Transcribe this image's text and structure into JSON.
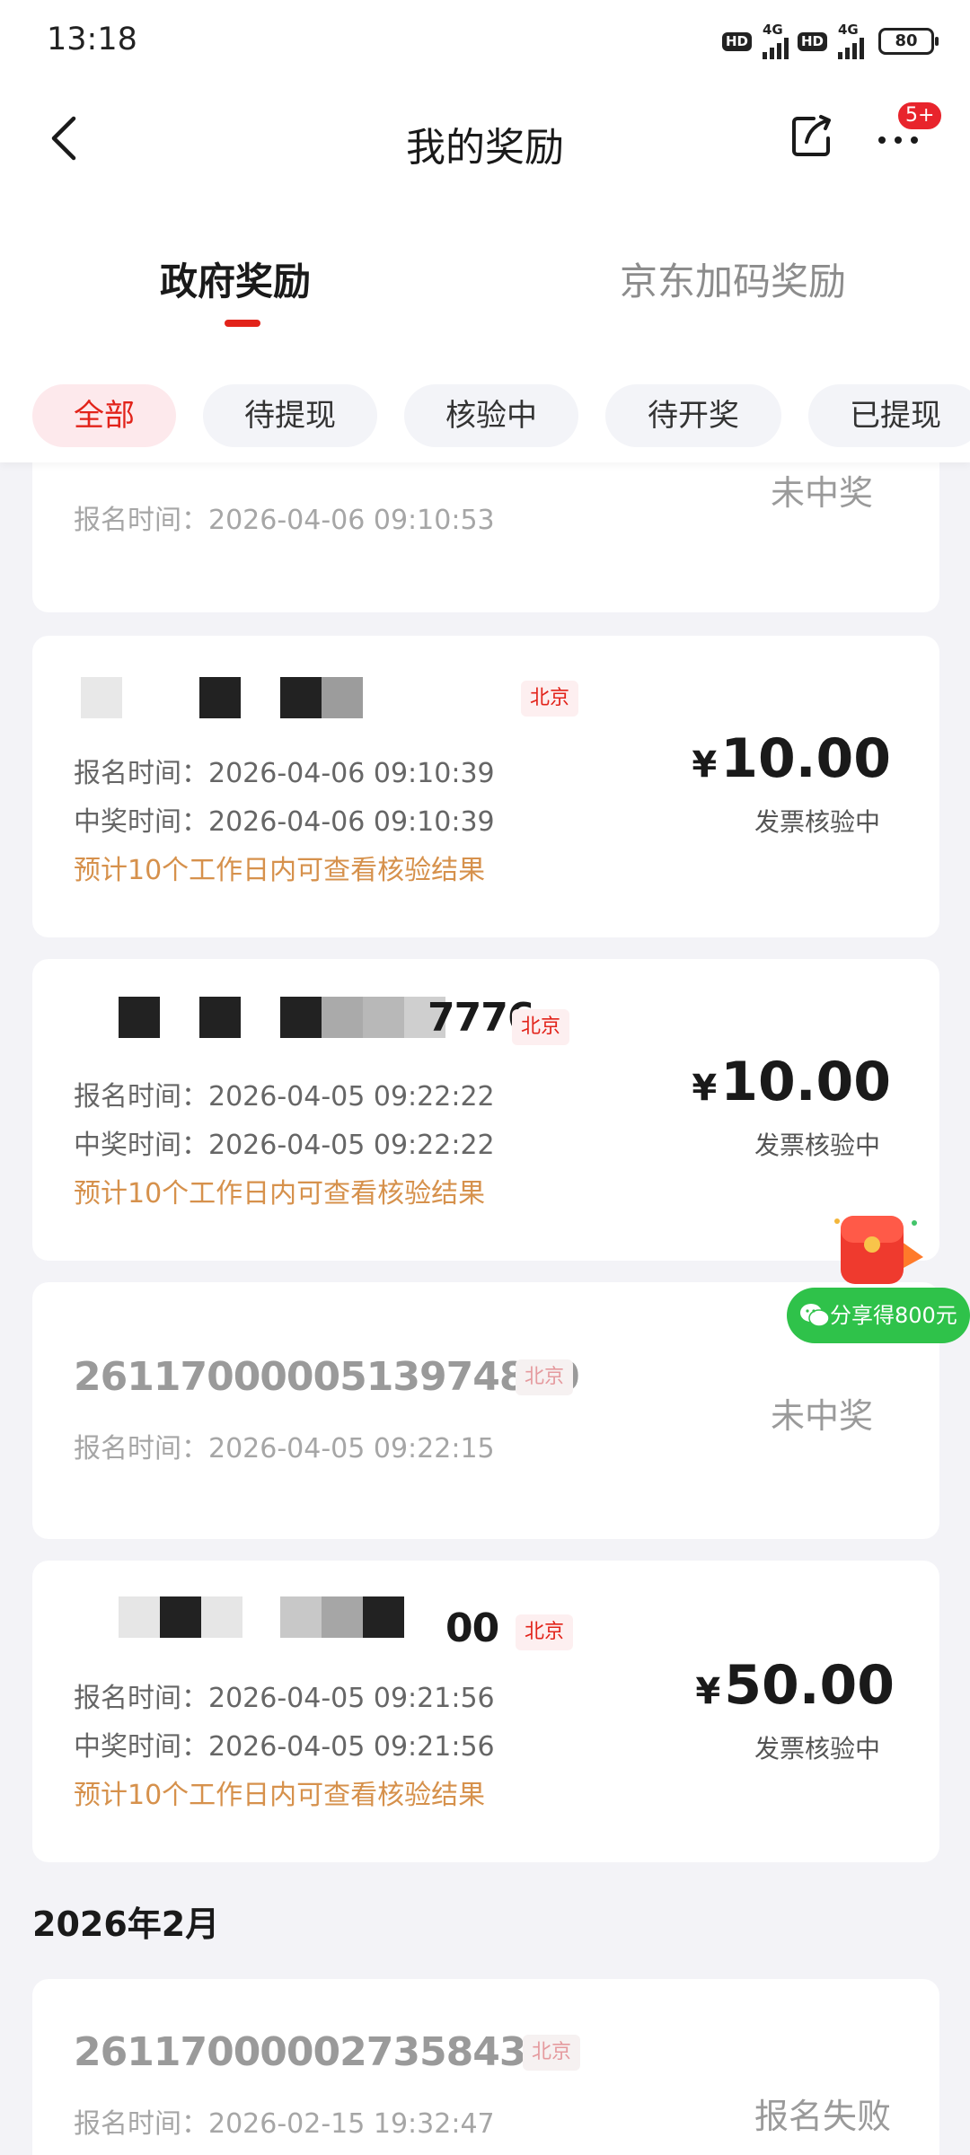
{
  "status_bar": {
    "time": "13:18",
    "battery": "80",
    "network": "4G",
    "hd": "HD"
  },
  "nav": {
    "title": "我的奖励",
    "badge": "5+"
  },
  "tabs": [
    {
      "label": "政府奖励",
      "active": true
    },
    {
      "label": "京东加码奖励",
      "active": false
    }
  ],
  "filters": [
    "全部",
    "待提现",
    "核验中",
    "待开奖",
    "已提现"
  ],
  "cards": [
    {
      "signup_time": "报名时间：2026-04-06 09:10:53",
      "status": "未中奖"
    },
    {
      "city": "北京",
      "signup_time": "报名时间：2026-04-06 09:10:39",
      "win_time": "中奖时间：2026-04-06 09:10:39",
      "hint": "预计10个工作日内可查看核验结果",
      "currency": "¥",
      "amount": "10.00",
      "status": "发票核验中"
    },
    {
      "number_tail": "7776",
      "city": "北京",
      "signup_time": "报名时间：2026-04-05 09:22:22",
      "win_time": "中奖时间：2026-04-05 09:22:22",
      "hint": "预计10个工作日内可查看核验结果",
      "currency": "¥",
      "amount": "10.00",
      "status": "发票核验中"
    },
    {
      "number": "2611700000513974800",
      "city": "北京",
      "signup_time": "报名时间：2026-04-05 09:22:15",
      "status": "未中奖"
    },
    {
      "number_tail": "00",
      "city": "北京",
      "signup_time": "报名时间：2026-04-05 09:21:56",
      "win_time": "中奖时间：2026-04-05 09:21:56",
      "hint": "预计10个工作日内可查看核验结果",
      "currency": "¥",
      "amount": "50.00",
      "status": "发票核验中"
    }
  ],
  "section": {
    "title": "2026年2月"
  },
  "feb_card": {
    "number": "2611700000273584385",
    "city": "北京",
    "signup_time": "报名时间：2026-02-15 19:32:47",
    "status": "报名失败"
  },
  "share_float": {
    "label": "分享得800元"
  },
  "colors": {
    "accent_red": "#e2231a",
    "hint_orange": "#d6914c",
    "share_green": "#2fc24a",
    "page_bg": "#f3f3f7"
  }
}
